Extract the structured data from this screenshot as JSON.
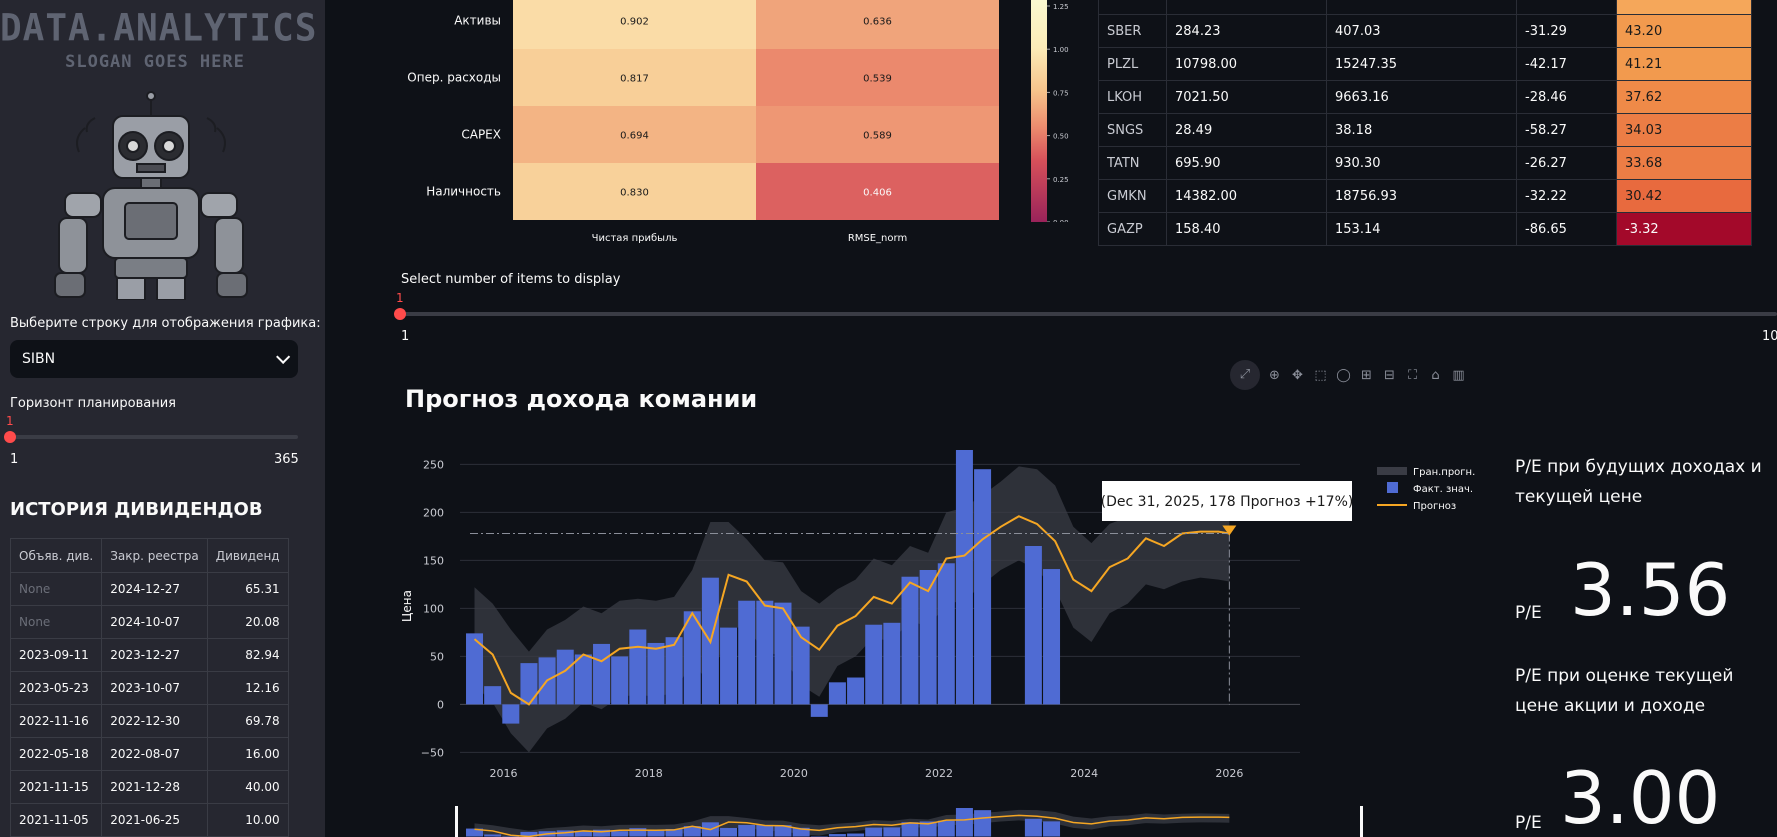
{
  "sidebar": {
    "logo_title": "DATA.ANALYTICS",
    "logo_slogan": "SLOGAN GOES HERE",
    "row_select_label": "Выберите строку для отображения графика:",
    "row_select_value": "SIBN",
    "horizon_label": "Горизонт планирования",
    "horizon_value": "1",
    "horizon_min": "1",
    "horizon_max": "365",
    "dividends_heading": "ИСТОРИЯ ДИВИДЕНДОВ",
    "dividends_columns": [
      "Объяв. див.",
      "Закр. реестра",
      "Дивиденд"
    ],
    "dividends_rows": [
      [
        "None",
        "2024-12-27",
        "65.31"
      ],
      [
        "None",
        "2024-10-07",
        "20.08"
      ],
      [
        "2023-09-11",
        "2023-12-27",
        "82.94"
      ],
      [
        "2023-05-23",
        "2023-10-07",
        "12.16"
      ],
      [
        "2022-11-16",
        "2022-12-30",
        "69.78"
      ],
      [
        "2022-05-18",
        "2022-08-07",
        "16.00"
      ],
      [
        "2021-11-15",
        "2021-12-28",
        "40.00"
      ],
      [
        "2021-11-05",
        "2021-06-25",
        "10.00"
      ]
    ]
  },
  "heatmap": {
    "rows": [
      "Активы",
      "Опер. расходы",
      "CAPEX",
      "Наличность"
    ],
    "columns": [
      "Чистая прибыль",
      "RMSE_norm"
    ],
    "values": [
      [
        0.902,
        0.636
      ],
      [
        0.817,
        0.539
      ],
      [
        0.694,
        0.589
      ],
      [
        0.83,
        0.406
      ]
    ],
    "colorbar_ticks": [
      "1.25",
      "1.00",
      "0.75",
      "0.50",
      "0.25",
      "0.00"
    ]
  },
  "ticker_table": {
    "rows": [
      [
        "SBER",
        "284.23",
        "407.03",
        "-31.29",
        "43.20"
      ],
      [
        "PLZL",
        "10798.00",
        "15247.35",
        "-42.17",
        "41.21"
      ],
      [
        "LKOH",
        "7021.50",
        "9663.16",
        "-28.46",
        "37.62"
      ],
      [
        "SNGS",
        "28.49",
        "38.18",
        "-58.27",
        "34.03"
      ],
      [
        "TATN",
        "695.90",
        "930.30",
        "-26.27",
        "33.68"
      ],
      [
        "GMKN",
        "14382.00",
        "18756.93",
        "-32.22",
        "30.42"
      ],
      [
        "GAZP",
        "158.40",
        "153.14",
        "-86.65",
        "-3.32"
      ]
    ],
    "highlight_colors": [
      "#f29a4e",
      "#f29a4e",
      "#ef8a48",
      "#ec7d45",
      "#ec7d45",
      "#e86a3e",
      "#a3092a"
    ]
  },
  "items_slider": {
    "label": "Select number of items to display",
    "value": "1",
    "min": "1",
    "max": "10"
  },
  "chart": {
    "title": "Прогноз дохода комании",
    "tooltip": "(Dec 31, 2025, 178 Прогноз +17%)",
    "legend": [
      "Гран.прогн.",
      "Факт. знач.",
      "Прогноз"
    ]
  },
  "chart_data": {
    "type": "bar",
    "ylabel": "Цена",
    "ylim": [
      -60,
      265
    ],
    "xlim": [
      2015.4,
      2027.8
    ],
    "x_ticks": [
      "2016",
      "2018",
      "2020",
      "2022",
      "2024",
      "2026"
    ],
    "y_ticks": [
      "250",
      "200",
      "150",
      "100",
      "50",
      "0",
      "−50"
    ],
    "reference_line": 178,
    "reference_x": 2026.0,
    "series": [
      {
        "name": "Факт. знач.",
        "type": "bar",
        "x": [
          2015.6,
          2015.85,
          2016.1,
          2016.35,
          2016.6,
          2016.85,
          2017.1,
          2017.35,
          2017.6,
          2017.85,
          2018.1,
          2018.35,
          2018.6,
          2018.85,
          2019.1,
          2019.35,
          2019.6,
          2019.85,
          2020.1,
          2020.35,
          2020.6,
          2020.85,
          2021.1,
          2021.35,
          2021.6,
          2021.85,
          2022.1,
          2022.35,
          2022.6,
          2023.3,
          2023.55
        ],
        "values": [
          74,
          19,
          -20,
          43,
          49,
          57,
          52,
          63,
          50,
          78,
          64,
          70,
          97,
          132,
          80,
          108,
          108,
          106,
          81,
          -13,
          23,
          28,
          83,
          85,
          133,
          140,
          147,
          265,
          245,
          165,
          141
        ]
      },
      {
        "name": "Прогноз",
        "type": "line",
        "x": [
          2015.6,
          2015.85,
          2016.1,
          2016.35,
          2016.6,
          2016.85,
          2017.1,
          2017.35,
          2017.6,
          2017.85,
          2018.1,
          2018.35,
          2018.6,
          2018.85,
          2019.1,
          2019.35,
          2019.6,
          2019.85,
          2020.1,
          2020.35,
          2020.6,
          2020.85,
          2021.1,
          2021.35,
          2021.6,
          2021.85,
          2022.1,
          2022.35,
          2022.6,
          2022.85,
          2023.1,
          2023.35,
          2023.6,
          2023.85,
          2024.1,
          2024.35,
          2024.6,
          2024.85,
          2025.1,
          2025.35,
          2025.6,
          2025.85,
          2026.0
        ],
        "values": [
          68,
          52,
          12,
          0,
          25,
          35,
          52,
          45,
          58,
          60,
          58,
          62,
          95,
          65,
          135,
          128,
          103,
          100,
          70,
          57,
          82,
          92,
          112,
          105,
          127,
          118,
          152,
          155,
          172,
          185,
          196,
          188,
          170,
          130,
          118,
          143,
          152,
          173,
          165,
          178,
          180,
          180,
          178
        ]
      },
      {
        "name": "Гран.прогн.",
        "type": "area",
        "x": [
          2015.6,
          2015.85,
          2016.1,
          2016.35,
          2016.6,
          2016.85,
          2017.1,
          2017.35,
          2017.6,
          2017.85,
          2018.1,
          2018.35,
          2018.6,
          2018.85,
          2019.1,
          2019.35,
          2019.6,
          2019.85,
          2020.1,
          2020.35,
          2020.6,
          2020.85,
          2021.1,
          2021.35,
          2021.6,
          2021.85,
          2022.1,
          2022.35,
          2022.6,
          2022.85,
          2023.1,
          2023.35,
          2023.6,
          2023.85,
          2024.1,
          2024.35,
          2024.6,
          2024.85,
          2025.1,
          2025.35,
          2025.6,
          2025.85,
          2026.0
        ],
        "upper": [
          122,
          105,
          78,
          55,
          78,
          88,
          102,
          95,
          108,
          110,
          108,
          112,
          140,
          190,
          190,
          172,
          150,
          148,
          118,
          105,
          120,
          130,
          152,
          145,
          165,
          158,
          200,
          205,
          218,
          232,
          248,
          245,
          228,
          185,
          168,
          188,
          195,
          215,
          205,
          212,
          215,
          212,
          210
        ],
        "lower": [
          20,
          2,
          -30,
          -50,
          -25,
          -15,
          2,
          -5,
          8,
          10,
          8,
          12,
          45,
          20,
          80,
          80,
          55,
          50,
          20,
          8,
          40,
          50,
          70,
          65,
          88,
          80,
          105,
          108,
          125,
          140,
          150,
          140,
          120,
          80,
          65,
          95,
          105,
          125,
          120,
          128,
          132,
          130,
          128
        ]
      }
    ]
  },
  "pe": {
    "title1": "P/E при будущих доходах и текущей цене",
    "label1": "P/E",
    "value1": "3.56",
    "title2": "P/E при оценке текущей цене акции и доходе",
    "label2": "P/E",
    "value2": "3.00"
  },
  "colors": {
    "accent": "#ff4b4b",
    "bar": "#4f6bd3",
    "forecast_line": "#f5a623",
    "band": "#3a3c45"
  }
}
